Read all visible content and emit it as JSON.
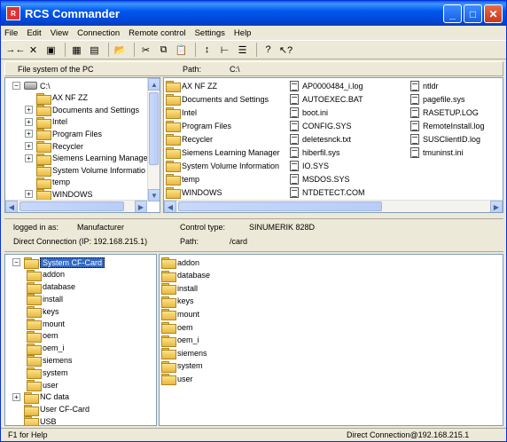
{
  "window": {
    "title": "RCS Commander",
    "minimize": "_",
    "maximize": "□",
    "close": "✕"
  },
  "menu": [
    "File",
    "Edit",
    "View",
    "Connection",
    "Remote control",
    "Settings",
    "Help"
  ],
  "toolbar": {
    "icons": [
      "connect-icon",
      "disconnect-icon",
      "save-icon",
      "calculator-icon",
      "info-panel-icon",
      "open-folder-icon",
      "cut-icon",
      "copy-icon",
      "paste-icon",
      "sort-icon",
      "tree-view-icon",
      "list-view-icon",
      "help-icon",
      "context-help-icon"
    ],
    "glyphs": [
      "→←",
      "✕",
      "▣",
      "▦",
      "▤",
      "📂",
      "✂",
      "⧉",
      "📋",
      "↕",
      "⊢",
      "☰",
      "?",
      "↖?"
    ]
  },
  "pc": {
    "label": "File system of the PC",
    "path_label": "Path:",
    "path_value": "C:\\",
    "tree": [
      {
        "label": "C:\\",
        "pm": "−",
        "indent": 0,
        "type": "drive"
      },
      {
        "label": "AX NF ZZ",
        "pm": "",
        "indent": 1
      },
      {
        "label": "Documents and Settings",
        "pm": "+",
        "indent": 1
      },
      {
        "label": "Intel",
        "pm": "+",
        "indent": 1
      },
      {
        "label": "Program Files",
        "pm": "+",
        "indent": 1
      },
      {
        "label": "Recycler",
        "pm": "+",
        "indent": 1
      },
      {
        "label": "Siemens Learning Manage",
        "pm": "+",
        "indent": 1
      },
      {
        "label": "System Volume Informatio",
        "pm": "",
        "indent": 1
      },
      {
        "label": "temp",
        "pm": "",
        "indent": 1
      },
      {
        "label": "WINDOWS",
        "pm": "+",
        "indent": 1
      }
    ],
    "files_col1": [
      "AX NF ZZ",
      "Documents and Settings",
      "Intel",
      "Program Files",
      "Recycler",
      "Siemens Learning Manager",
      "System Volume Information",
      "temp",
      "WINDOWS"
    ],
    "files_col2": [
      "AP0000484_i.log",
      "AUTOEXEC.BAT",
      "boot.ini",
      "CONFIG.SYS",
      "deletesnck.txt",
      "hiberfil.sys",
      "IO.SYS",
      "MSDOS.SYS",
      "NTDETECT.COM"
    ],
    "files_col3": [
      "ntldr",
      "pagefile.sys",
      "RASETUP.LOG",
      "RemoteInstall.log",
      "SUSClientID.log",
      "tmuninst.ini"
    ]
  },
  "nc": {
    "logged_label": "logged in as:",
    "logged_value": "Manufacturer",
    "control_label": "Control type:",
    "control_value": "SINUMERIK 828D",
    "conn_label": "Direct Connection (IP: 192.168.215.1)",
    "path_label": "Path:",
    "path_value": "/card",
    "tree": [
      {
        "label": "System CF-Card",
        "pm": "−",
        "indent": 0,
        "selected": true
      },
      {
        "label": "addon",
        "pm": "",
        "indent": 1
      },
      {
        "label": "database",
        "pm": "",
        "indent": 1
      },
      {
        "label": "install",
        "pm": "",
        "indent": 1
      },
      {
        "label": "keys",
        "pm": "",
        "indent": 1
      },
      {
        "label": "mount",
        "pm": "",
        "indent": 1
      },
      {
        "label": "oem",
        "pm": "",
        "indent": 1
      },
      {
        "label": "oem_i",
        "pm": "",
        "indent": 1
      },
      {
        "label": "siemens",
        "pm": "",
        "indent": 1
      },
      {
        "label": "system",
        "pm": "",
        "indent": 1
      },
      {
        "label": "user",
        "pm": "",
        "indent": 1
      },
      {
        "label": "NC data",
        "pm": "+",
        "indent": 0
      },
      {
        "label": "User CF-Card",
        "pm": "",
        "indent": 0
      },
      {
        "label": "USB",
        "pm": "",
        "indent": 0
      }
    ],
    "files": [
      "addon",
      "database",
      "install",
      "keys",
      "mount",
      "oem",
      "oem_i",
      "siemens",
      "system",
      "user"
    ]
  },
  "status": {
    "left": "F1 for Help",
    "right": "Direct Connection@192.168.215.1"
  }
}
